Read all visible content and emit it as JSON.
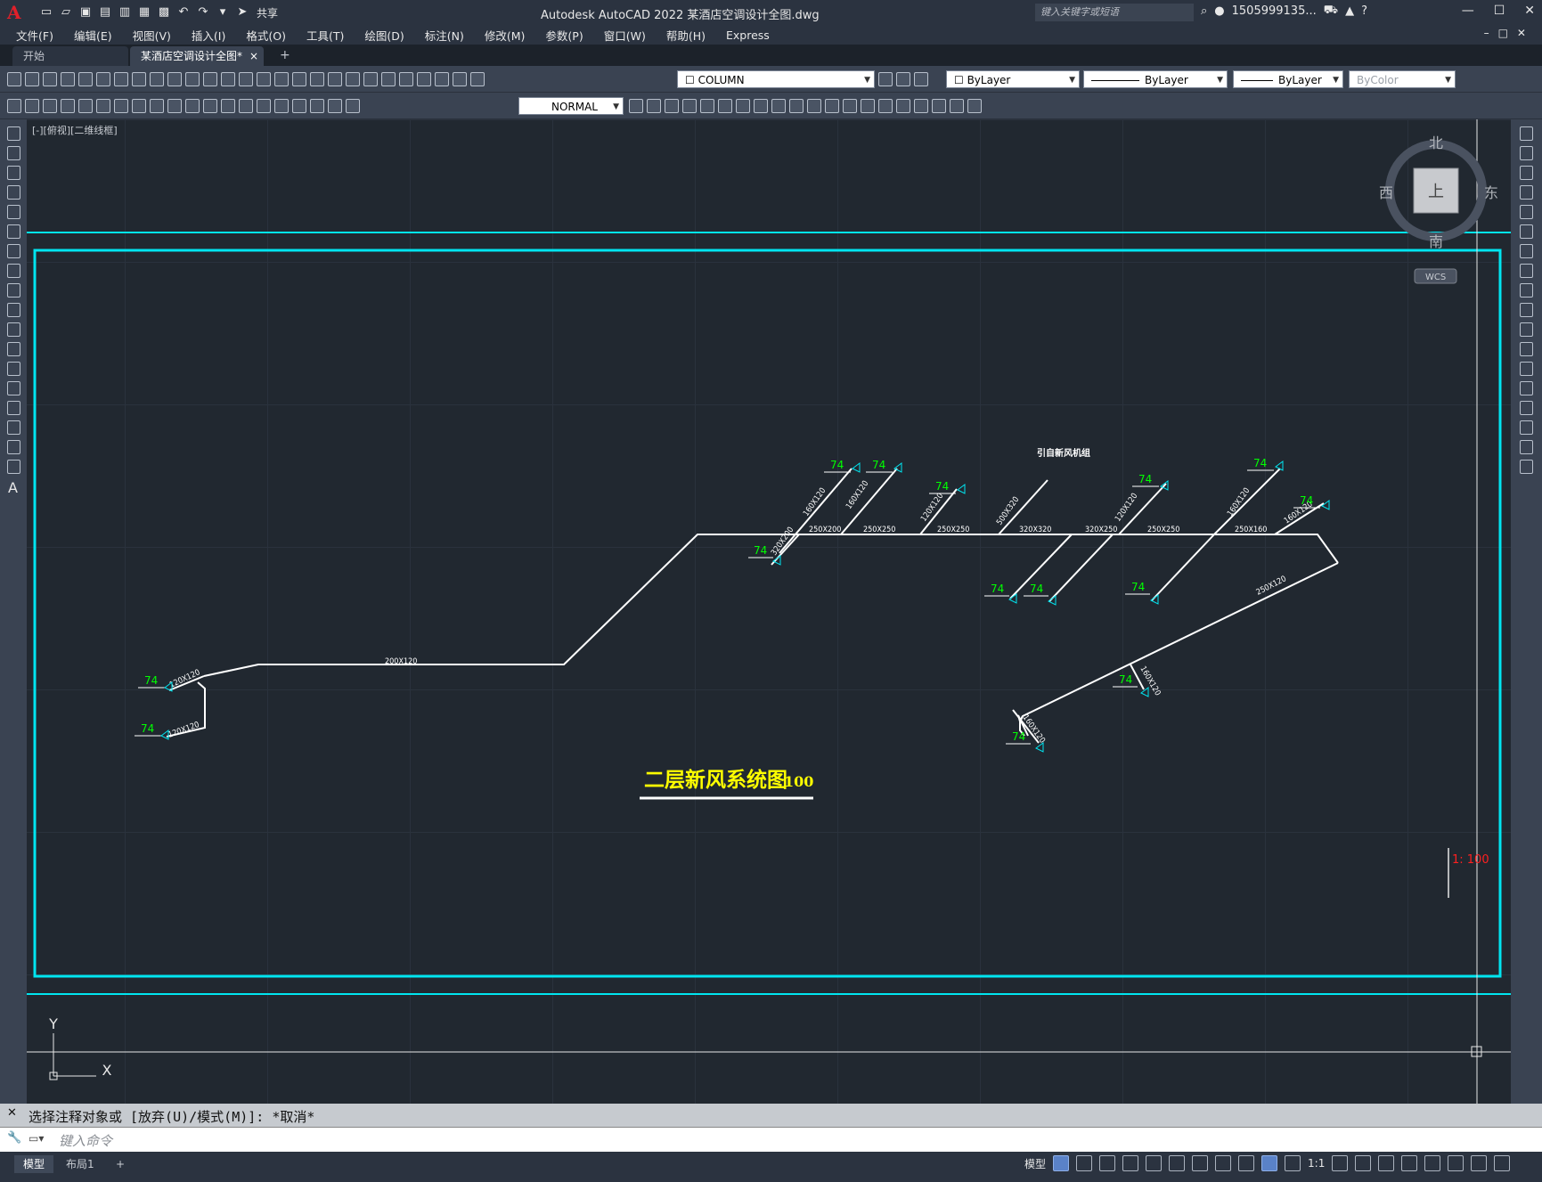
{
  "titlebar": {
    "app_title": "Autodesk AutoCAD 2022    某酒店空调设计全图.dwg",
    "share_label": "共享",
    "search_placeholder": "键入关键字或短语",
    "user": "1505999135...",
    "cart_icon": "cart-icon",
    "help_label": "?"
  },
  "menubar": {
    "items": [
      "文件(F)",
      "编辑(E)",
      "视图(V)",
      "插入(I)",
      "格式(O)",
      "工具(T)",
      "绘图(D)",
      "标注(N)",
      "修改(M)",
      "参数(P)",
      "窗口(W)",
      "帮助(H)",
      "Express"
    ]
  },
  "tabs": {
    "start": "开始",
    "drawing": "某酒店空调设计全图*",
    "close": "×",
    "add": "+"
  },
  "toolbar": {
    "layer": "COLUMN",
    "color": "ByLayer",
    "linetype": "ByLayer",
    "lineweight": "ByLayer",
    "plotstyle": "ByColor",
    "dimstyle": "NORMAL"
  },
  "viewport": {
    "label": "[-][俯视][二维线框]",
    "viewcube": {
      "north": "北",
      "south": "南",
      "east": "东",
      "west": "西",
      "face": "上",
      "wcs": "WCS"
    },
    "ucs": {
      "x": "X",
      "y": "Y"
    },
    "scale_note": "1: 100"
  },
  "drawing": {
    "title": "二层新风系统图",
    "title_suffix": "100",
    "small_title": "引自新风机组",
    "diffuser_label": "74",
    "duct_labels": {
      "main_left": "200X120",
      "left_branch_top": "120X120",
      "left_branch_bottom": "120X120",
      "d1": "320X200",
      "d2": "250X200",
      "d3": "250X250",
      "d4": "250X250",
      "d5": "320X320",
      "d6": "320X250",
      "d7": "250X250",
      "d8": "250X160",
      "d9": "160X120",
      "b1": "160X120",
      "b2": "160X120",
      "b3": "120X120",
      "b4": "500X320",
      "b5": "120X120",
      "b6": "160X120",
      "b7": "160X120",
      "diag": "250X120",
      "low1": "160X120",
      "low2": "160X120"
    }
  },
  "command": {
    "history": "选择注释对象或 [放弃(U)/模式(M)]: *取消*",
    "placeholder": "键入命令"
  },
  "status": {
    "model_tab": "模型",
    "layout_tab": "布局1",
    "add_tab": "+",
    "model_label": "模型",
    "scale": "1:1"
  },
  "colors": {
    "border": "#00e5f0",
    "duct": "#ffffff",
    "diffuser": "#00ff00",
    "title": "#ffff00",
    "scale_note": "#ff2020"
  }
}
